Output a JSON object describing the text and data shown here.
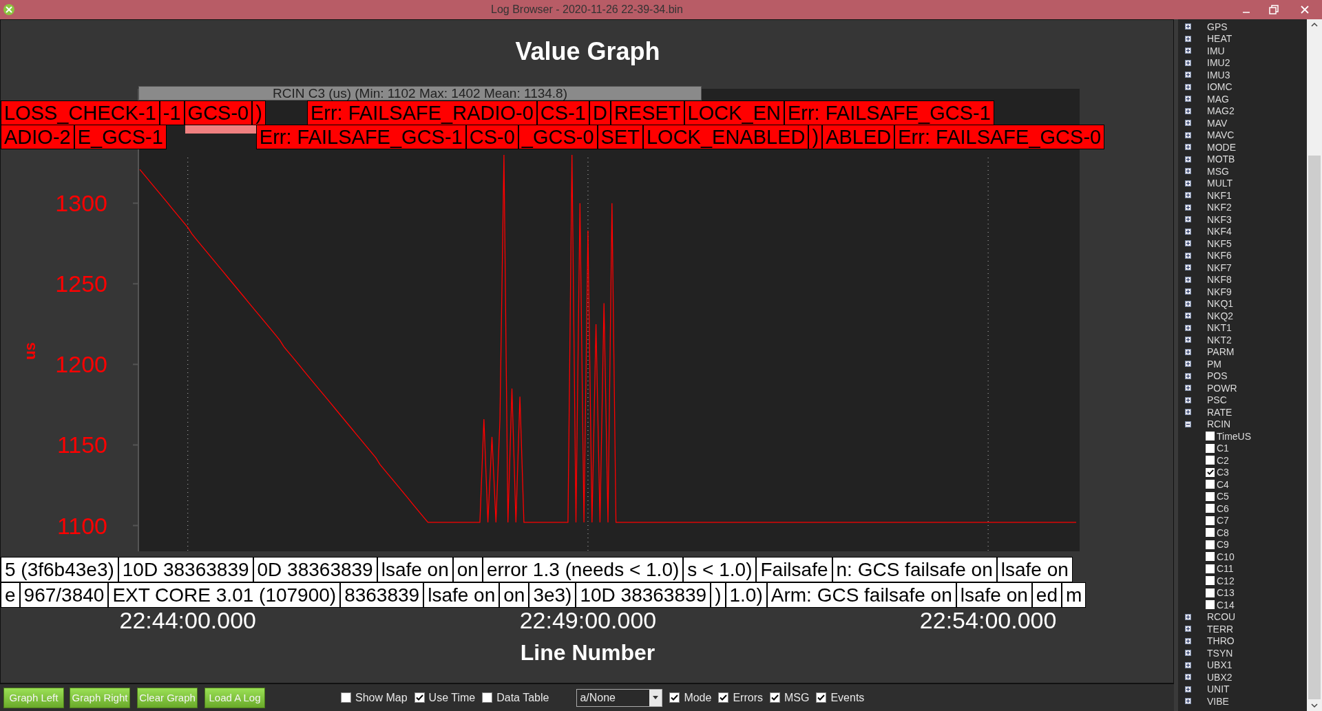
{
  "window": {
    "title": "Log Browser - 2020-11-26 22-39-34.bin"
  },
  "graph": {
    "chart_data": {
      "type": "line",
      "title": "Value Graph",
      "xlabel": "Line Number",
      "ylabel": "us",
      "categories": [
        null,
        null,
        null,
        null,
        null,
        null,
        null,
        null,
        null,
        null,
        null,
        null,
        "22:44:00.000",
        null,
        null,
        null,
        null,
        null,
        null,
        null,
        null,
        null,
        null,
        null,
        null,
        null,
        null,
        null,
        null,
        null,
        null,
        null,
        null,
        null,
        null,
        null,
        null,
        null,
        null,
        null,
        null,
        null,
        null,
        null,
        null,
        null,
        null,
        null,
        null,
        null,
        null,
        null,
        null,
        null,
        null,
        null,
        null,
        null,
        null,
        null,
        null,
        null,
        null,
        null,
        null,
        null,
        null,
        null,
        null,
        null,
        null,
        null,
        null,
        null,
        null,
        null,
        null,
        null,
        null,
        null,
        null,
        null,
        null,
        null,
        null,
        null,
        null,
        null,
        null,
        null,
        null,
        null,
        null,
        null,
        null,
        null,
        null,
        null,
        null,
        null,
        null,
        null,
        null,
        null,
        null,
        null,
        null,
        null,
        null,
        null,
        null,
        null,
        "22:49:00.000",
        null,
        null,
        null,
        null,
        null,
        null,
        null,
        null,
        null,
        null,
        null,
        null,
        null,
        null,
        null,
        null,
        null,
        null,
        null,
        null,
        null,
        null,
        null,
        null,
        null,
        null,
        null,
        null,
        null,
        null,
        null,
        null,
        null,
        null,
        null,
        null,
        null,
        null,
        null,
        null,
        null,
        null,
        null,
        null,
        null,
        null,
        null,
        null,
        null,
        null,
        null,
        null,
        null,
        null,
        null,
        null,
        null,
        null,
        null,
        null,
        null,
        null,
        null,
        null,
        null,
        null,
        null,
        null,
        null,
        null,
        null,
        null,
        null,
        null,
        null,
        null,
        null,
        null,
        null,
        null,
        null,
        null,
        null,
        null,
        null,
        null,
        null,
        null,
        null,
        null,
        null,
        null,
        null,
        null,
        null,
        null,
        null,
        null,
        null,
        "22:54:00.000",
        null,
        null,
        null,
        null,
        null,
        null,
        null,
        null,
        null,
        null,
        null,
        null,
        null,
        null,
        null,
        null,
        null,
        null,
        null,
        null,
        null,
        null
      ],
      "series": [
        {
          "name": "RCIN C3 (us) (Min: 1102 Max: 1402 Mean: 1134.8)",
          "color": "#ff0000",
          "values": [
            1321,
            1318,
            1315,
            1312,
            1309,
            1306,
            1303,
            1300,
            1297,
            1294,
            1291,
            1288,
            1285,
            1281,
            1278,
            1275,
            1272,
            1269,
            1266,
            1263,
            1260,
            1257,
            1254,
            1251,
            1248,
            1245,
            1242,
            1239,
            1236,
            1233,
            1230,
            1227,
            1224,
            1221,
            1218,
            1215,
            1211,
            1208,
            1205,
            1202,
            1199,
            1196,
            1193,
            1190,
            1187,
            1184,
            1181,
            1178,
            1175,
            1172,
            1169,
            1166,
            1163,
            1160,
            1157,
            1154,
            1151,
            1148,
            1145,
            1142,
            1138,
            1135,
            1132,
            1129,
            1126,
            1123,
            1120,
            1117,
            1114,
            1111,
            1108,
            1105,
            1102,
            1102,
            1102,
            1102,
            1102,
            1102,
            1102,
            1102,
            1102,
            1102,
            1102,
            1102,
            1102,
            1102,
            1166,
            1102,
            1155,
            1102,
            1166,
            1330,
            1102,
            1185,
            1102,
            1180,
            1102,
            1102,
            1102,
            1102,
            1102,
            1102,
            1102,
            1102,
            1102,
            1102,
            1102,
            1102,
            1330,
            1102,
            1300,
            1102,
            1283,
            1102,
            1225,
            1102,
            1238,
            1102,
            1300,
            1102,
            1102,
            1102,
            1102,
            1102,
            1102,
            1102,
            1102,
            1102,
            1102,
            1102,
            1102,
            1102,
            1102,
            1102,
            1102,
            1102,
            1102,
            1102,
            1102,
            1102,
            1102,
            1102,
            1102,
            1102,
            1102,
            1102,
            1102,
            1102,
            1102,
            1102,
            1102,
            1102,
            1102,
            1102,
            1102,
            1102,
            1102,
            1102,
            1102,
            1102,
            1102,
            1102,
            1102,
            1102,
            1102,
            1102,
            1102,
            1102,
            1102,
            1102,
            1102,
            1102,
            1102,
            1102,
            1102,
            1102,
            1102,
            1102,
            1102,
            1102,
            1102,
            1102,
            1102,
            1102,
            1102,
            1102,
            1102,
            1102,
            1102,
            1102,
            1102,
            1102,
            1102,
            1102,
            1102,
            1102,
            1102,
            1102,
            1102,
            1102,
            1102,
            1102,
            1102,
            1102,
            1102,
            1102,
            1102,
            1102,
            1102,
            1102,
            1102,
            1102,
            1102,
            1102,
            1102,
            1102,
            1102,
            1102,
            1102,
            1102,
            1102,
            1102,
            1102,
            1102,
            1102,
            1102,
            1102,
            1102,
            1102,
            1102,
            1102,
            1102,
            1102,
            1102,
            1102
          ]
        }
      ],
      "ylim": [
        1084,
        1371
      ],
      "yticks": [
        1100,
        1150,
        1200,
        1250,
        1300
      ]
    },
    "error_labels": [
      [
        "LOSS_CHECK-1",
        "-1",
        "GCS-0",
        ")",
        "Err: FAILSAFE_RADIO-0",
        "CS-1",
        "D",
        "RESET",
        "LOCK_EN",
        "Err: FAILSAFE_GCS-1"
      ],
      [
        "ADIO-2",
        "E_GCS-1",
        "Err: FAILSAFE_GCS-1",
        "CS-0",
        "_GCS-0",
        "SET",
        "LOCK_ENABLED",
        ")",
        "ABLED",
        "Err: FAILSAFE_GCS-0"
      ]
    ],
    "message_labels": [
      [
        "5 (3f6b43e3)",
        "10D 38363839",
        "0D 38363839",
        "lsafe on",
        "on",
        "error 1.3 (needs < 1.0)",
        "s < 1.0)",
        "Failsafe",
        "n: GCS failsafe on",
        "lsafe on"
      ],
      [
        "e",
        "967/3840",
        "EXT CORE 3.01 (107900)",
        "8363839",
        "lsafe on",
        "on",
        "3e3)",
        "10D 38363839",
        ")",
        "1.0)",
        "Arm: GCS failsafe on",
        "lsafe on",
        "ed",
        "m"
      ]
    ]
  },
  "toolbar": {
    "buttons": [
      "Graph Left",
      "Graph Right",
      "Clear Graph",
      "Load A Log"
    ],
    "controls": [
      {
        "kind": "checkbox",
        "label": "Show Map",
        "checked": false
      },
      {
        "kind": "checkbox",
        "label": "Use Time",
        "checked": true
      },
      {
        "kind": "checkbox",
        "label": "Data Table",
        "checked": false
      },
      {
        "kind": "dropdown",
        "value": "a/None"
      },
      {
        "kind": "checkbox",
        "label": "Mode",
        "checked": true
      },
      {
        "kind": "checkbox",
        "label": "Errors",
        "checked": true
      },
      {
        "kind": "checkbox",
        "label": "MSG",
        "checked": true
      },
      {
        "kind": "checkbox",
        "label": "Events",
        "checked": true
      }
    ]
  },
  "tree": {
    "items": [
      {
        "label": "GPS",
        "expanded": false
      },
      {
        "label": "HEAT",
        "expanded": false
      },
      {
        "label": "IMU",
        "expanded": false
      },
      {
        "label": "IMU2",
        "expanded": false
      },
      {
        "label": "IMU3",
        "expanded": false
      },
      {
        "label": "IOMC",
        "expanded": false
      },
      {
        "label": "MAG",
        "expanded": false
      },
      {
        "label": "MAG2",
        "expanded": false
      },
      {
        "label": "MAV",
        "expanded": false
      },
      {
        "label": "MAVC",
        "expanded": false
      },
      {
        "label": "MODE",
        "expanded": false
      },
      {
        "label": "MOTB",
        "expanded": false
      },
      {
        "label": "MSG",
        "expanded": false
      },
      {
        "label": "MULT",
        "expanded": false
      },
      {
        "label": "NKF1",
        "expanded": false
      },
      {
        "label": "NKF2",
        "expanded": false
      },
      {
        "label": "NKF3",
        "expanded": false
      },
      {
        "label": "NKF4",
        "expanded": false
      },
      {
        "label": "NKF5",
        "expanded": false
      },
      {
        "label": "NKF6",
        "expanded": false
      },
      {
        "label": "NKF7",
        "expanded": false
      },
      {
        "label": "NKF8",
        "expanded": false
      },
      {
        "label": "NKF9",
        "expanded": false
      },
      {
        "label": "NKQ1",
        "expanded": false
      },
      {
        "label": "NKQ2",
        "expanded": false
      },
      {
        "label": "NKT1",
        "expanded": false
      },
      {
        "label": "NKT2",
        "expanded": false
      },
      {
        "label": "PARM",
        "expanded": false
      },
      {
        "label": "PM",
        "expanded": false
      },
      {
        "label": "POS",
        "expanded": false
      },
      {
        "label": "POWR",
        "expanded": false
      },
      {
        "label": "PSC",
        "expanded": false
      },
      {
        "label": "RATE",
        "expanded": false
      },
      {
        "label": "RCIN",
        "expanded": true,
        "children": [
          {
            "label": "TimeUS",
            "checked": false
          },
          {
            "label": "C1",
            "checked": false
          },
          {
            "label": "C2",
            "checked": false
          },
          {
            "label": "C3",
            "checked": true
          },
          {
            "label": "C4",
            "checked": false
          },
          {
            "label": "C5",
            "checked": false
          },
          {
            "label": "C6",
            "checked": false
          },
          {
            "label": "C7",
            "checked": false
          },
          {
            "label": "C8",
            "checked": false
          },
          {
            "label": "C9",
            "checked": false
          },
          {
            "label": "C10",
            "checked": false
          },
          {
            "label": "C11",
            "checked": false
          },
          {
            "label": "C12",
            "checked": false
          },
          {
            "label": "C13",
            "checked": false
          },
          {
            "label": "C14",
            "checked": false
          }
        ]
      },
      {
        "label": "RCOU",
        "expanded": false
      },
      {
        "label": "TERR",
        "expanded": false
      },
      {
        "label": "THRO",
        "expanded": false
      },
      {
        "label": "TSYN",
        "expanded": false
      },
      {
        "label": "UBX1",
        "expanded": false
      },
      {
        "label": "UBX2",
        "expanded": false
      },
      {
        "label": "UNIT",
        "expanded": false
      },
      {
        "label": "VIBE",
        "expanded": false
      }
    ]
  }
}
